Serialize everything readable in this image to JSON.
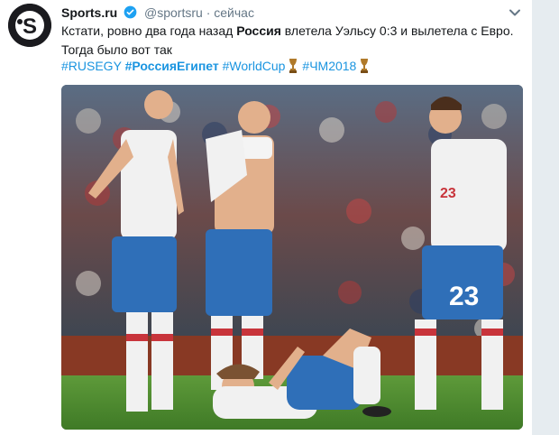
{
  "account": {
    "name": "Sports.ru",
    "handle": "@sportsru",
    "separator": "·",
    "time": "сейчас",
    "avatar_letter": "S",
    "avatar_icon": "sportsru-logo"
  },
  "tweet": {
    "text_part1": "Кстати, ровно два года назад ",
    "text_bold": "Россия",
    "text_part2": " влетела Уэльсу 0:3 и вылетела с Евро.",
    "text_line2": "Тогда было вот так",
    "hashtags": [
      "#RUSEGY",
      "#РоссияЕгипет",
      "#WorldCup",
      "#ЧМ2018"
    ],
    "trophy_icon": "worldcup-trophy-emoji"
  },
  "photo": {
    "jersey_numbers": [
      "23",
      "23"
    ],
    "icon": "football-players-photo"
  },
  "colors": {
    "link": "#1b95e0",
    "verified": "#1da1f2",
    "text": "#14171a",
    "muted": "#657786"
  }
}
